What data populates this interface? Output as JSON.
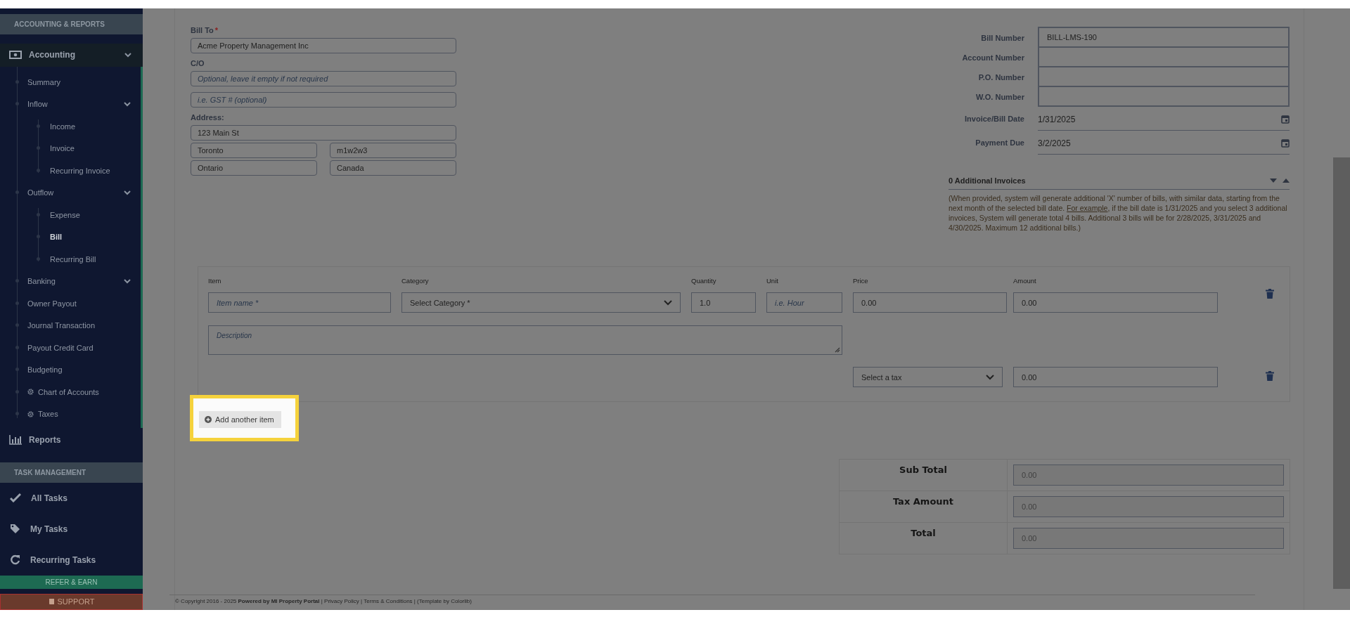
{
  "sidebar": {
    "sections": [
      {
        "header": "ACCOUNTING & REPORTS",
        "items": [
          {
            "label": "Accounting",
            "kind": "submenu",
            "children": [
              {
                "label": "Summary",
                "kind": "link",
                "selected": false
              },
              {
                "label": "Inflow",
                "kind": "submenu",
                "children": [
                  {
                    "label": "Income",
                    "kind": "link",
                    "selected": false
                  },
                  {
                    "label": "Invoice",
                    "kind": "link",
                    "selected": false
                  },
                  {
                    "label": "Recurring Invoice",
                    "kind": "link",
                    "selected": false
                  }
                ]
              },
              {
                "label": "Outflow",
                "kind": "submenu",
                "children": [
                  {
                    "label": "Expense",
                    "kind": "link",
                    "selected": false
                  },
                  {
                    "label": "Bill",
                    "kind": "link",
                    "selected": true
                  },
                  {
                    "label": "Recurring Bill",
                    "kind": "link",
                    "selected": false
                  }
                ]
              },
              {
                "label": "Banking",
                "kind": "submenu"
              },
              {
                "label": "Owner Payout",
                "kind": "link",
                "selected": false
              },
              {
                "label": "Journal Transaction",
                "kind": "link",
                "selected": false
              },
              {
                "label": "Payout Credit Card",
                "kind": "link",
                "selected": false
              },
              {
                "label": "Budgeting",
                "kind": "link",
                "selected": false
              },
              {
                "label": "Chart of Accounts",
                "kind": "setting",
                "selected": false
              },
              {
                "label": "Taxes",
                "kind": "setting",
                "selected": false
              }
            ]
          },
          {
            "label": "Reports"
          }
        ]
      },
      {
        "header": "TASK MANAGEMENT",
        "items": [
          {
            "label": "All Tasks"
          },
          {
            "label": "My Tasks"
          },
          {
            "label": "Recurring Tasks"
          }
        ]
      }
    ],
    "refer_button": "REFER & EARN",
    "support_button": "SUPPORT"
  },
  "bill_to": {
    "label": "Bill To",
    "required_mark": "*",
    "value": "Acme Property Management Inc"
  },
  "care_of": {
    "label": "C/O",
    "placeholder": "Optional, leave it empty if not required"
  },
  "tax_id": {
    "placeholder": "i.e. GST # (optional)"
  },
  "address": {
    "label": "Address:",
    "street": "123 Main St",
    "city": "Toronto",
    "postal_code": "m1w2w3",
    "province": "Ontario",
    "country": "Canada"
  },
  "bill_details": [
    {
      "label": "Bill Number",
      "kind": "text",
      "value": "BILL-LMS-190"
    },
    {
      "label": "Account Number",
      "kind": "text"
    },
    {
      "label": "P.O. Number",
      "kind": "text"
    },
    {
      "label": "W.O. Number",
      "kind": "text"
    },
    {
      "label": "Invoice/Bill Date",
      "kind": "date",
      "value": "1/31/2025"
    },
    {
      "label": "Payment Due",
      "kind": "date",
      "value": "3/2/2025"
    }
  ],
  "additional_invoices": {
    "label": "0 Additional Invoices",
    "note_before": "(When provided, system will generate additional 'X' number of bills, with similar data, starting from the next month of the selected bill date. ",
    "note_link": "For example",
    "note_after": ", if the bill date is 1/31/2025 and you select 3 additional invoices, System will generate total 4 bills. Additional 3 bills will be for 2/28/2025, 3/31/2025 and 4/30/2025. Maximum 12 additional bills.)"
  },
  "line_items": {
    "columns": [
      "Item",
      "Category",
      "Quantity",
      "Unit",
      "Price",
      "Amount"
    ],
    "rows": [
      {
        "item_placeholder": "Item name *",
        "category": "Select Category *",
        "quantity": "1.0",
        "unit_placeholder": "i.e. Hour",
        "price": "0.00",
        "amount": "0.00",
        "description_placeholder": "Description",
        "tax": "Select a tax",
        "tax_amount": "0.00"
      }
    ]
  },
  "add_item": {
    "label": "Add another item",
    "highlighted": true
  },
  "totals": [
    {
      "label": "Sub Total",
      "value": "0.00"
    },
    {
      "label": "Tax Amount",
      "value": "0.00"
    },
    {
      "label": "Total",
      "value": "0.00"
    }
  ],
  "footer": "© Copyright 2016 - 2025 **Powered by MI Property Portal** | Privacy Policy | Terms & Conditions | (Template by Colorlib)"
}
